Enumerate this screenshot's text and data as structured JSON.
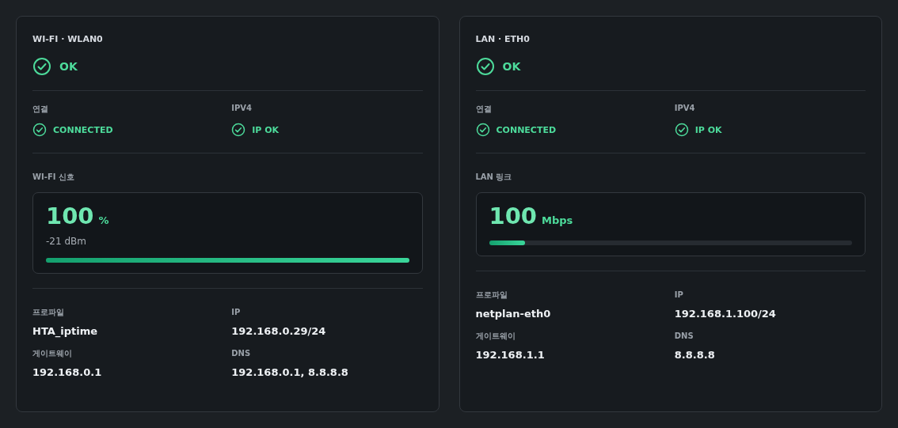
{
  "cards": [
    {
      "title": "WI-FI · WLAN0",
      "status": {
        "text": "OK",
        "ok": true
      },
      "checks": [
        {
          "label": "연결",
          "value": "CONNECTED",
          "ok": true
        },
        {
          "label": "IPV4",
          "value": "IP OK",
          "ok": true
        }
      ],
      "meter": {
        "label": "WI-FI 신호",
        "value": "100",
        "unit": "%",
        "reading": "-21 dBm",
        "level": 1.0
      },
      "details": [
        {
          "label": "프로파일",
          "value": "HTA_iptime"
        },
        {
          "label": "IP",
          "value": "192.168.0.29/24"
        },
        {
          "label": "게이트웨이",
          "value": "192.168.0.1"
        },
        {
          "label": "DNS",
          "value": "192.168.0.1, 8.8.8.8"
        }
      ]
    },
    {
      "title": "LAN · ETH0",
      "status": {
        "text": "OK",
        "ok": true
      },
      "checks": [
        {
          "label": "연결",
          "value": "CONNECTED",
          "ok": true
        },
        {
          "label": "IPV4",
          "value": "IP OK",
          "ok": true
        }
      ],
      "meter": {
        "label": "LAN 링크",
        "value": "100",
        "unit": "Mbps",
        "level": 0.1
      },
      "details": [
        {
          "label": "프로파일",
          "value": "netplan-eth0"
        },
        {
          "label": "IP",
          "value": "192.168.1.100/24"
        },
        {
          "label": "게이트웨이",
          "value": "192.168.1.1"
        },
        {
          "label": "DNS",
          "value": "8.8.8.8"
        }
      ]
    }
  ]
}
